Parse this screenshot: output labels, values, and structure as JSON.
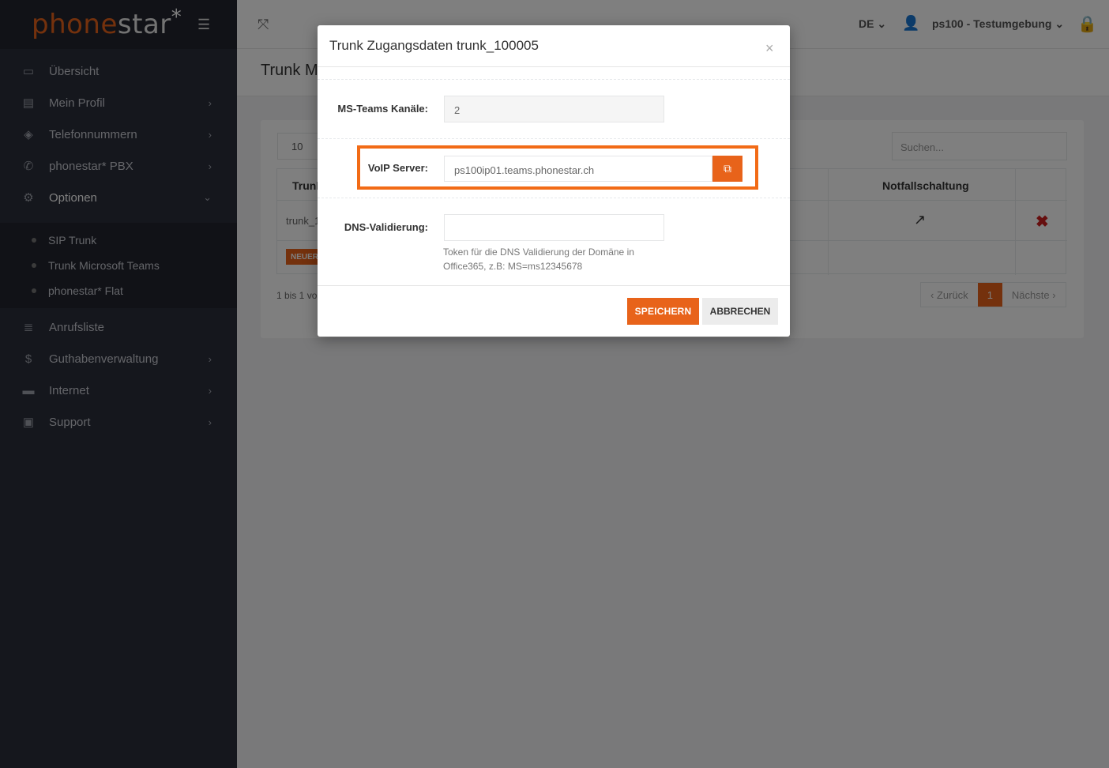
{
  "brand": {
    "logo_main": "phone",
    "logo_tail": "star",
    "logo_star": "*"
  },
  "sidebar": {
    "items": [
      {
        "label": "Übersicht",
        "icon": "monitor-icon"
      },
      {
        "label": "Mein Profil",
        "icon": "file-icon"
      },
      {
        "label": "Telefonnummern",
        "icon": "tags-icon"
      },
      {
        "label": "phonestar* PBX",
        "icon": "phone-icon"
      },
      {
        "label": "Optionen",
        "icon": "gears-icon"
      },
      {
        "label": "Anrufsliste",
        "icon": "list-icon"
      },
      {
        "label": "Guthabenverwaltung",
        "icon": "dollar-icon"
      },
      {
        "label": "Internet",
        "icon": "laptop-icon"
      },
      {
        "label": "Support",
        "icon": "medkit-icon"
      }
    ],
    "submenu": [
      {
        "label": "SIP Trunk"
      },
      {
        "label": "Trunk Microsoft Teams"
      },
      {
        "label": "phonestar* Flat"
      }
    ]
  },
  "topbar": {
    "language": "DE",
    "user": "ps100 - Testumgebung"
  },
  "page": {
    "title": "Trunk M",
    "page_length": "10",
    "search_placeholder": "Suchen...",
    "col_trunk": "Trunk",
    "col_notfall": "Notfallschaltung",
    "row_trunk": "trunk_1",
    "new_badge": "NEUER",
    "info": "1 bis 1 vo",
    "pagination": {
      "prev": "Zurück",
      "current": "1",
      "next": "Nächste"
    }
  },
  "modal": {
    "title": "Trunk Zugangsdaten trunk_100005",
    "close": "×",
    "fields": {
      "channels_label": "MS-Teams Kanäle:",
      "channels_value": "2",
      "voip_label": "VoIP Server:",
      "voip_value": "ps100ip01.teams.phonestar.ch",
      "dns_label": "DNS-Validierung:",
      "dns_value": "",
      "dns_help": "Token für die DNS Validierung der Domäne in Office365, z.B: MS=ms12345678"
    },
    "buttons": {
      "save": "SPEICHERN",
      "cancel": "ABBRECHEN"
    }
  },
  "colors": {
    "accent": "#e8631a",
    "highlight": "#f26b16",
    "sidebar": "#2b2e3a",
    "delete": "#cc1f1f"
  }
}
